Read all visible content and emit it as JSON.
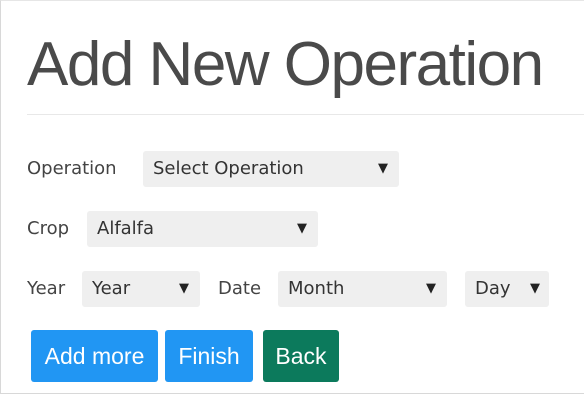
{
  "header": {
    "title": "Add New Operation"
  },
  "form": {
    "operation": {
      "label": "Operation",
      "value": "Select Operation"
    },
    "crop": {
      "label": "Crop",
      "value": "Alfalfa"
    },
    "year": {
      "label": "Year",
      "value": "Year"
    },
    "date": {
      "label": "Date",
      "month_value": "Month",
      "day_value": "Day"
    }
  },
  "buttons": {
    "add_more": "Add more",
    "finish": "Finish",
    "back": "Back"
  },
  "icons": {
    "select_caret": "caret-down-icon",
    "caret_glyph": "▼"
  },
  "colors": {
    "primary_button": "#2196f3",
    "back_button": "#0c7a5c",
    "select_background": "#efefef",
    "title_text": "#4a4a4a"
  }
}
